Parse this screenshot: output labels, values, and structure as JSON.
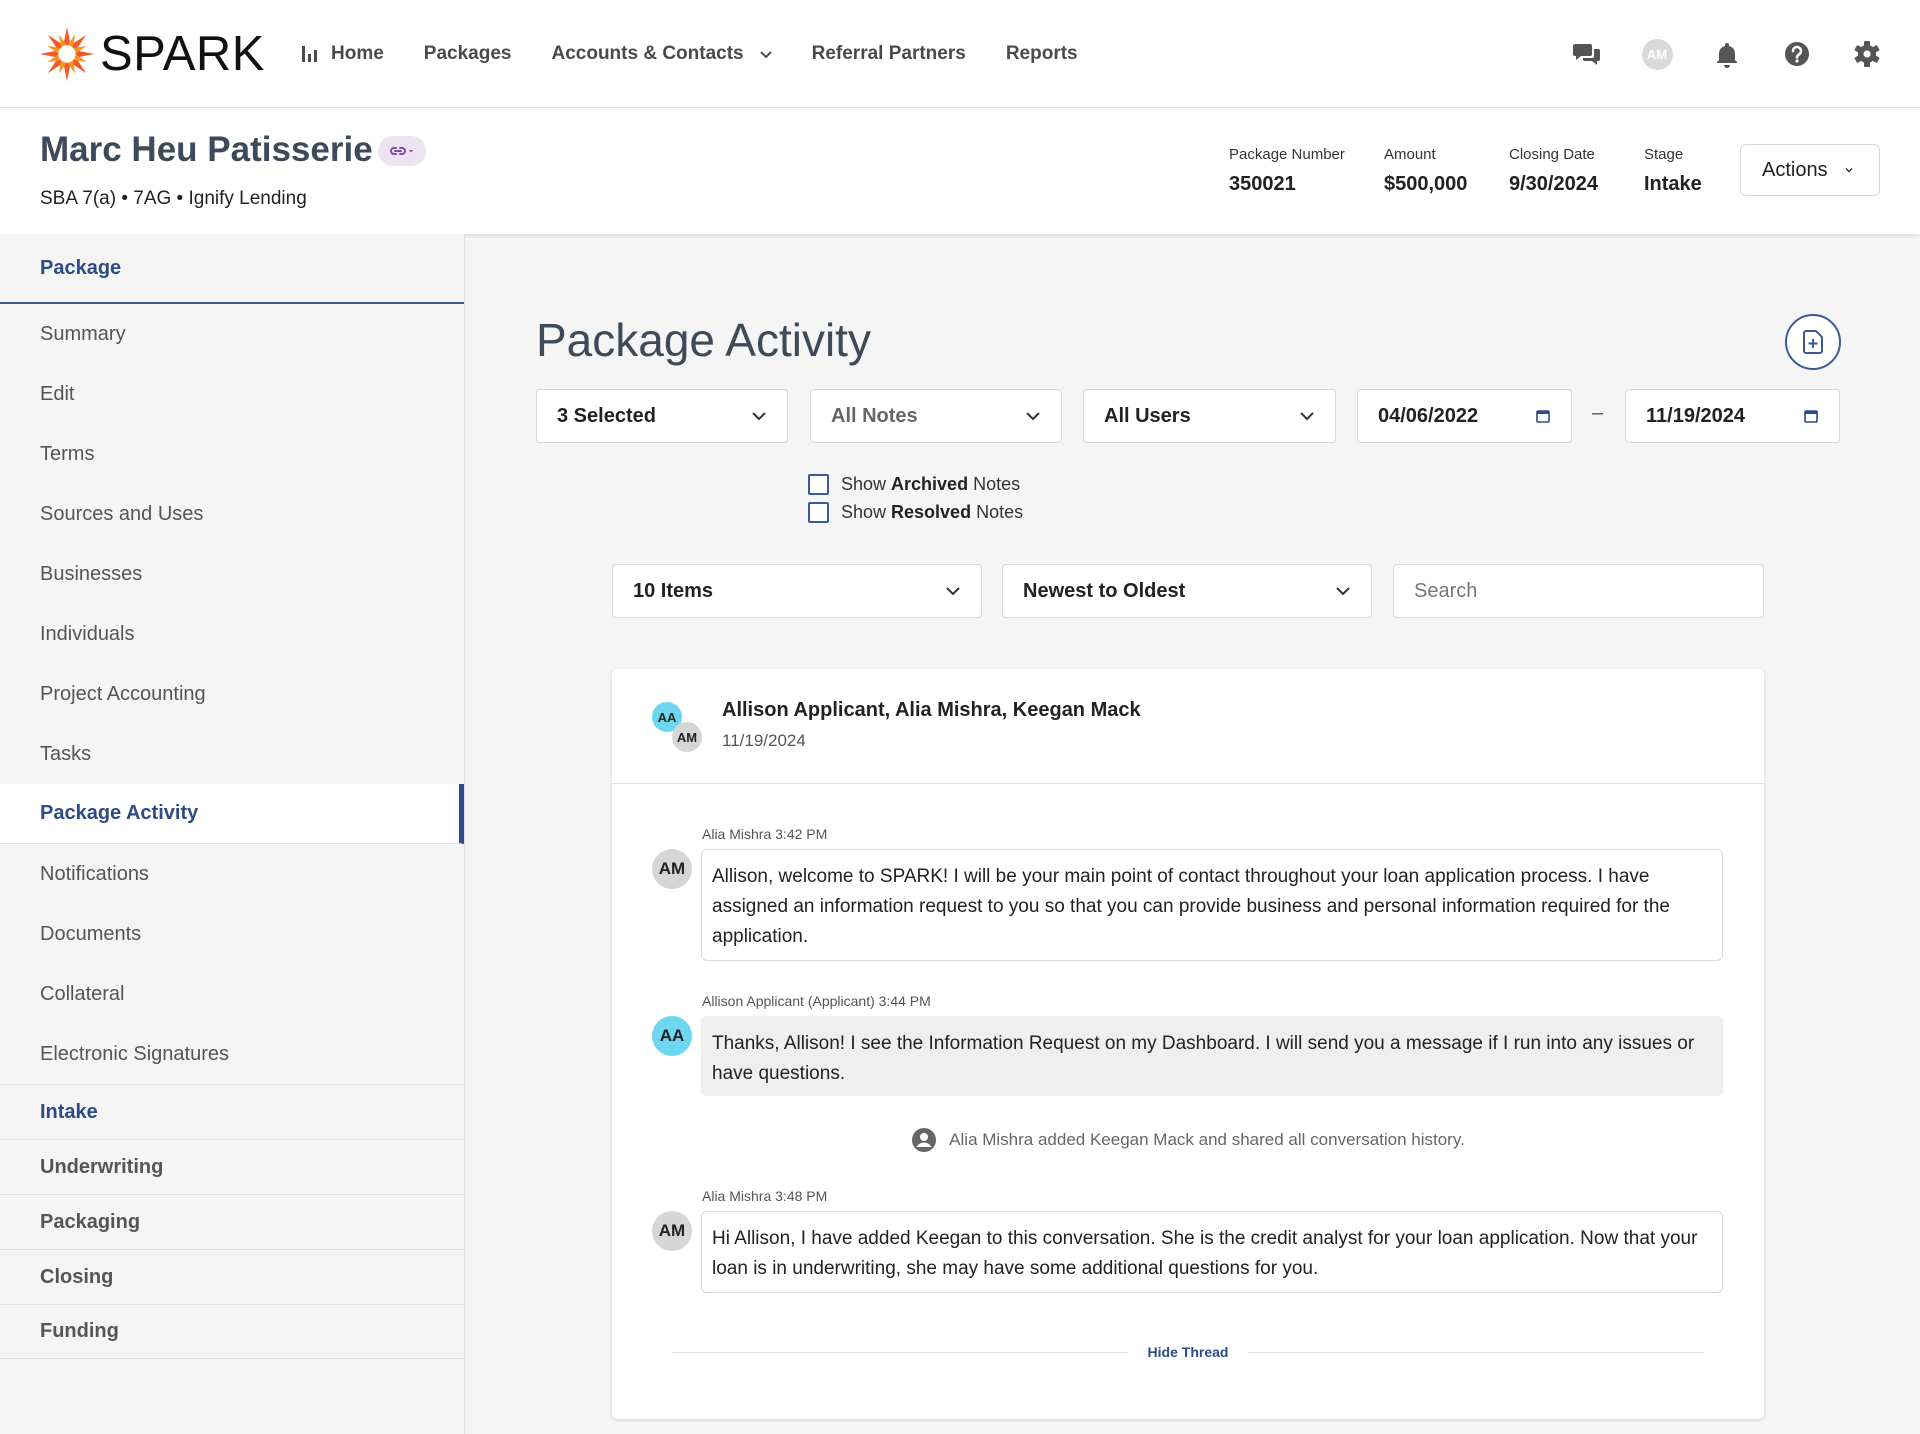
{
  "brand": {
    "name": "SPARK",
    "accent": "#f15a24",
    "primary": "#2d4b86"
  },
  "nav": {
    "links": [
      "Home",
      "Packages",
      "Accounts & Contacts",
      "Referral Partners",
      "Reports"
    ],
    "icons": [
      "chat-icon",
      "avatar",
      "bell-icon",
      "help-icon",
      "gear-icon"
    ],
    "avatar_initials": "AM"
  },
  "header": {
    "title": "Marc Heu Patisserie",
    "subtitle": "SBA 7(a) • 7AG • Ignify Lending",
    "meta": [
      {
        "label": "Package Number",
        "value": "350021"
      },
      {
        "label": "Amount",
        "value": "$500,000"
      },
      {
        "label": "Closing Date",
        "value": "9/30/2024"
      },
      {
        "label": "Stage",
        "value": "Intake"
      }
    ],
    "actions_label": "Actions"
  },
  "sidebar": {
    "head": "Package",
    "items": [
      "Summary",
      "Edit",
      "Terms",
      "Sources and Uses",
      "Businesses",
      "Individuals",
      "Project Accounting",
      "Tasks",
      "Package Activity",
      "Notifications",
      "Documents",
      "Collateral",
      "Electronic Signatures"
    ],
    "active_item": "Package Activity",
    "sections": [
      "Intake",
      "Underwriting",
      "Packaging",
      "Closing",
      "Funding"
    ]
  },
  "main": {
    "title": "Package Activity",
    "filters": {
      "type": "3 Selected",
      "notes": "All Notes",
      "users": "All Users",
      "date_from": "04/06/2022",
      "date_sep": "–",
      "date_to": "11/19/2024"
    },
    "checkboxes": [
      {
        "pre": "Show ",
        "bold": "Archived",
        "post": " Notes"
      },
      {
        "pre": "Show ",
        "bold": "Resolved",
        "post": " Notes"
      }
    ],
    "page_size": "10 Items",
    "sort": "Newest to Oldest",
    "search_placeholder": "Search"
  },
  "thread": {
    "participants": "Allison Applicant, Alia Mishra, Keegan Mack",
    "date": "11/19/2024",
    "avatars": [
      "AA",
      "AM"
    ],
    "messages": [
      {
        "author": "Alia Mishra",
        "time": "3:42 PM",
        "initials": "AM",
        "text": "Allison, welcome to SPARK! I will be your main point of contact throughout your loan application process. I have assigned an information request to you so that you can provide business and personal information required for the application."
      },
      {
        "author": "Allison Applicant (Applicant)",
        "time": "3:44 PM",
        "initials": "AA",
        "text": "Thanks, Allison! I see the Information Request on my Dashboard. I will send you a message if I run into any issues or have questions."
      },
      {
        "author": "Alia Mishra",
        "time": "3:48 PM",
        "initials": "AM",
        "text": "Hi Allison, I have added Keegan to this conversation. She is the credit analyst for your loan application. Now that your loan is in underwriting, she may have some additional questions for you."
      }
    ],
    "system_event": "Alia Mishra added Keegan Mack and shared all conversation history.",
    "hide_label": "Hide Thread"
  }
}
